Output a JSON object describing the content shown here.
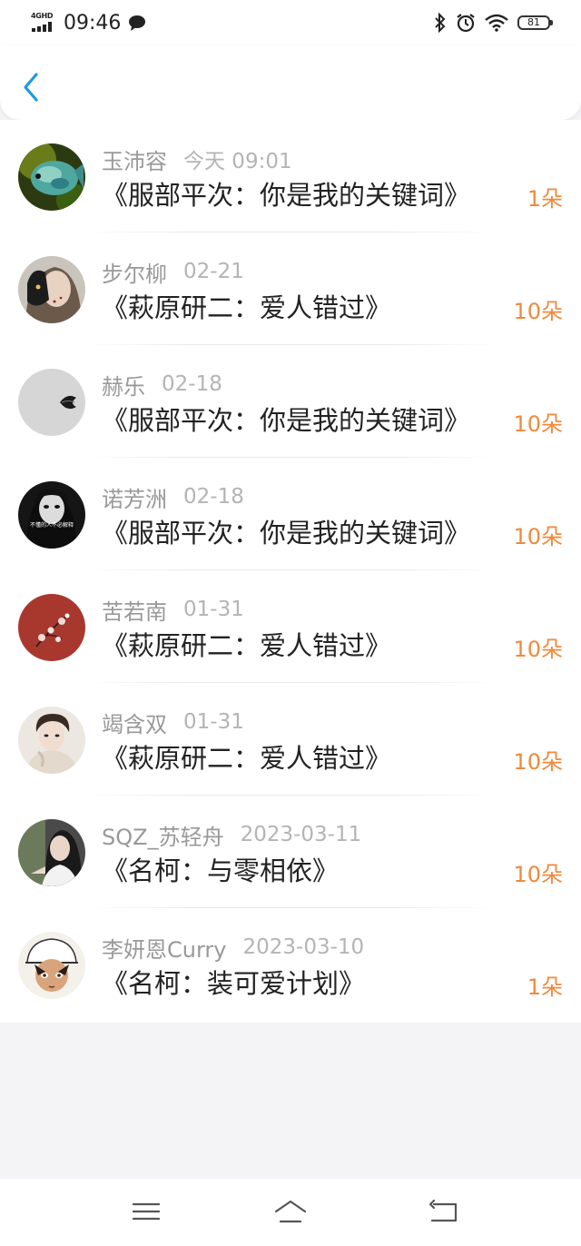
{
  "status_bar": {
    "network": "4GHD",
    "time": "09:46",
    "battery": "81",
    "icons": [
      "signal-icon",
      "chat-notification-icon",
      "bluetooth-icon",
      "alarm-icon",
      "wifi-icon",
      "battery-icon"
    ]
  },
  "header": {
    "back_icon": "chevron-left-icon",
    "accent_color": "#1a9be6"
  },
  "colors": {
    "count": "#f08a3c",
    "name": "#999999",
    "title": "#222222",
    "background": "#f4f4f6"
  },
  "items": [
    {
      "name": "玉沛容",
      "date": "今天 09:01",
      "title": "《服部平次：你是我的关键词》",
      "count": "1朵"
    },
    {
      "name": "步尔柳",
      "date": "02-21",
      "title": "《萩原研二：爱人错过》",
      "count": "10朵"
    },
    {
      "name": "赫乐",
      "date": "02-18",
      "title": "《服部平次：你是我的关键词》",
      "count": "10朵"
    },
    {
      "name": "诺芳洲",
      "date": "02-18",
      "title": "《服部平次：你是我的关键词》",
      "count": "10朵"
    },
    {
      "name": "苦若南",
      "date": "01-31",
      "title": "《萩原研二：爱人错过》",
      "count": "10朵"
    },
    {
      "name": "竭含双",
      "date": "01-31",
      "title": "《萩原研二：爱人错过》",
      "count": "10朵"
    },
    {
      "name": "SQZ_苏轻舟",
      "date": "2023-03-11",
      "title": "《名柯：与零相依》",
      "count": "10朵"
    },
    {
      "name": "李妍恩Curry",
      "date": "2023-03-10",
      "title": "《名柯：装可爱计划》",
      "count": "1朵"
    }
  ],
  "avatar_texts": {
    "item4": "不懂的人不必解释"
  },
  "nav": {
    "icons": [
      "menu-icon",
      "home-icon",
      "back-nav-icon"
    ]
  }
}
